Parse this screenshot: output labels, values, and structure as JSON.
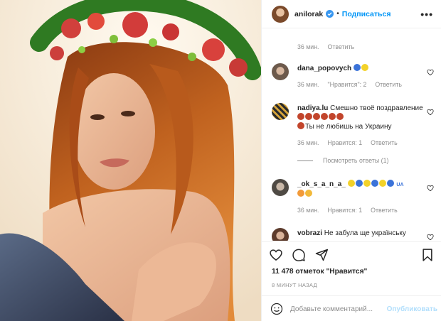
{
  "header": {
    "username": "anilorak",
    "separator": "•",
    "follow_label": "Подписаться",
    "more_label": "•••"
  },
  "top_meta": {
    "time": "36 мин.",
    "reply": "Ответить"
  },
  "comments": [
    {
      "user": "dana_popovych",
      "text": "",
      "emojis": [
        "blue-heart",
        "yellow-heart"
      ],
      "time": "36 мин.",
      "likes": "\"Нравится\": 2",
      "reply": "Ответить"
    },
    {
      "user": "nadiya.lu",
      "text": "Смешно твоё поздравление",
      "text2": "Ты не любишь на Украину",
      "emojis": [
        "devil",
        "devil",
        "devil",
        "devil",
        "devil",
        "devil"
      ],
      "time": "36 мин.",
      "likes": "Нравится: 1",
      "reply": "Ответить",
      "view_replies": "Посмотреть ответы (1)"
    },
    {
      "user": "_ok_s_a_n_a_",
      "text": "",
      "flag": "UA",
      "emojis": [
        "yellow-heart",
        "blue-heart",
        "yellow-heart",
        "blue-heart",
        "yellow-heart",
        "blue-heart"
      ],
      "time": "36 мин.",
      "likes": "Нравится: 1",
      "reply": "Ответить"
    },
    {
      "user": "vobrazi",
      "text": "Не забула ще українську"
    }
  ],
  "actions": {
    "likes": "11 478 отметок \"Нравится\"",
    "time_ago": "8 МИНУТ НАЗАД",
    "comment_placeholder": "Добавьте комментарий...",
    "publish_label": "Опубликовать"
  },
  "colors": {
    "accent": "#0095f6",
    "publish_disabled": "#b2dffc",
    "muted": "#8e8e8e",
    "border": "#efefef"
  }
}
